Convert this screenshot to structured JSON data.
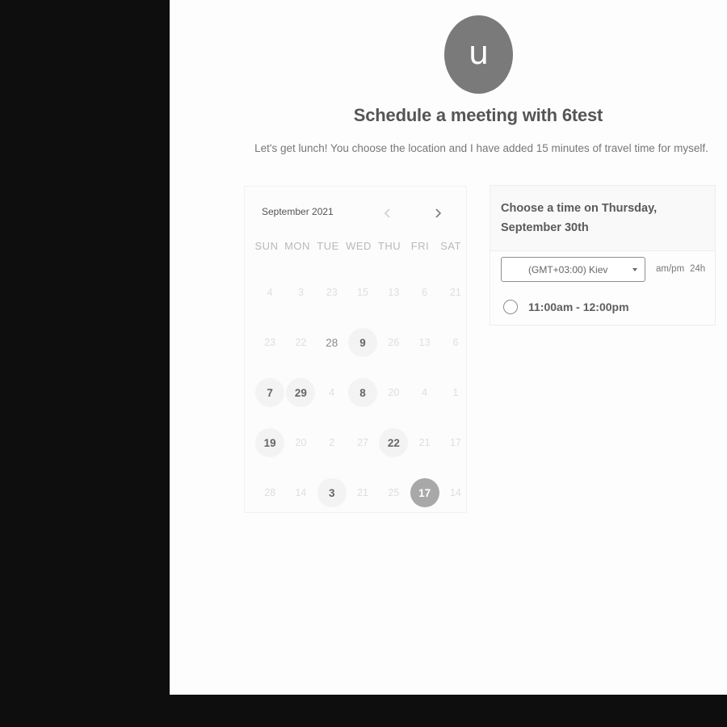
{
  "host": {
    "avatar_initial": "u"
  },
  "title": "Schedule a meeting with 6test",
  "description": "Let's get lunch! You choose the location and I have added 15 minutes of travel time for myself.",
  "calendar": {
    "month_label": "September 2021",
    "prev_icon": "chevron-left-icon",
    "next_icon": "chevron-right-icon",
    "weekdays": [
      "SUN",
      "MON",
      "TUE",
      "WED",
      "THU",
      "FRI",
      "SAT"
    ],
    "weeks": [
      [
        {
          "label": "4",
          "state": "disabled"
        },
        {
          "label": "3",
          "state": "disabled"
        },
        {
          "label": "23",
          "state": "disabled"
        },
        {
          "label": "15",
          "state": "disabled"
        },
        {
          "label": "13",
          "state": "disabled"
        },
        {
          "label": "6",
          "state": "disabled"
        },
        {
          "label": "21",
          "state": "disabled"
        }
      ],
      [
        {
          "label": "23",
          "state": "disabled"
        },
        {
          "label": "22",
          "state": "disabled"
        },
        {
          "label": "28",
          "state": "semi"
        },
        {
          "label": "9",
          "state": "available"
        },
        {
          "label": "26",
          "state": "disabled"
        },
        {
          "label": "13",
          "state": "disabled"
        },
        {
          "label": "6",
          "state": "disabled"
        }
      ],
      [
        {
          "label": "7",
          "state": "available"
        },
        {
          "label": "29",
          "state": "available"
        },
        {
          "label": "4",
          "state": "disabled"
        },
        {
          "label": "8",
          "state": "available"
        },
        {
          "label": "20",
          "state": "disabled"
        },
        {
          "label": "4",
          "state": "disabled"
        },
        {
          "label": "1",
          "state": "disabled"
        }
      ],
      [
        {
          "label": "19",
          "state": "available"
        },
        {
          "label": "20",
          "state": "disabled"
        },
        {
          "label": "2",
          "state": "disabled"
        },
        {
          "label": "27",
          "state": "disabled"
        },
        {
          "label": "22",
          "state": "available"
        },
        {
          "label": "21",
          "state": "disabled"
        },
        {
          "label": "17",
          "state": "disabled"
        }
      ],
      [
        {
          "label": "28",
          "state": "disabled"
        },
        {
          "label": "14",
          "state": "disabled"
        },
        {
          "label": "3",
          "state": "available"
        },
        {
          "label": "21",
          "state": "disabled"
        },
        {
          "label": "25",
          "state": "disabled"
        },
        {
          "label": "17",
          "state": "selected"
        },
        {
          "label": "14",
          "state": "disabled"
        }
      ]
    ]
  },
  "time_panel": {
    "heading": "Choose a time on Thursday, September 30th",
    "timezone": "(GMT+03:00) Kiev",
    "format_ampm": "am/pm",
    "format_24h": "24h",
    "slots": [
      {
        "label": "11:00am - 12:00pm",
        "selected": false
      }
    ]
  },
  "colors": {
    "background_outer": "#0e0e0e",
    "panel": "#fdfdfd",
    "avatar": "#7a7a7a",
    "selected_day": "#a8a8a8",
    "available_day_bg": "#f3f3f3"
  }
}
